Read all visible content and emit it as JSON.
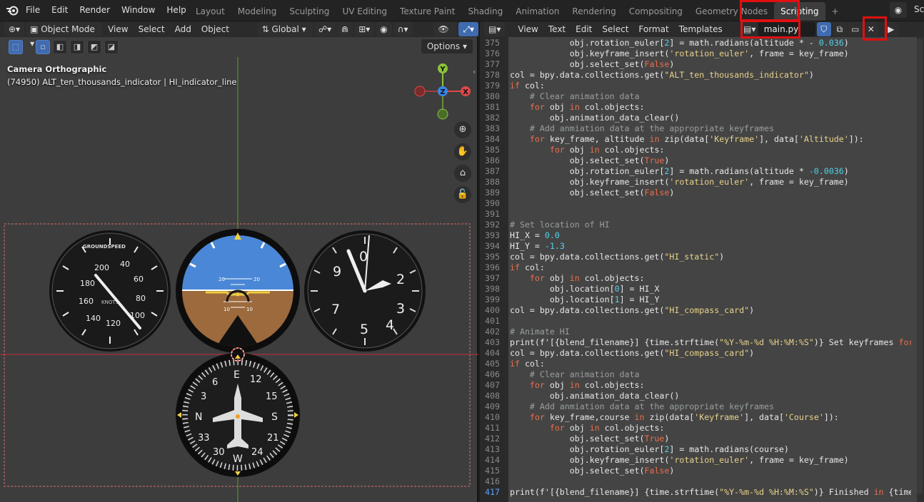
{
  "menu": {
    "items": [
      "File",
      "Edit",
      "Render",
      "Window",
      "Help"
    ]
  },
  "workspaces": [
    {
      "label": "Layout"
    },
    {
      "label": "Modeling"
    },
    {
      "label": "Sculpting"
    },
    {
      "label": "UV Editing"
    },
    {
      "label": "Texture Paint"
    },
    {
      "label": "Shading"
    },
    {
      "label": "Animation"
    },
    {
      "label": "Rendering"
    },
    {
      "label": "Compositing"
    },
    {
      "label": "Geometry Nodes"
    },
    {
      "label": "Scripting"
    }
  ],
  "active_workspace": "Scripting",
  "topright_scene": "Sc",
  "viewport": {
    "mode": "Object Mode",
    "menu": [
      "View",
      "Select",
      "Add",
      "Object"
    ],
    "transform": "Global",
    "options": "Options",
    "info_line1": "Camera Orthographic",
    "info_line2": "(74950) ALT_ten_thousands_indicator | HI_indicator_line",
    "gizmo": {
      "y": "Y",
      "z": "Z",
      "x": "X"
    }
  },
  "instruments": {
    "airspeed": {
      "title": "GROUNDSPEED",
      "unit": "KNOTS",
      "labels": [
        "200",
        "40",
        "180",
        "60",
        "160",
        "80",
        "140",
        "100",
        "120"
      ]
    },
    "attitude": {
      "labels": [
        "20",
        "10",
        "10",
        "20",
        "20",
        "10",
        "10",
        "20"
      ]
    },
    "altimeter": {
      "labels": [
        "0",
        "9",
        "2",
        "3",
        "7",
        "5",
        "4"
      ]
    },
    "heading": {
      "labels": [
        "E",
        "12",
        "15",
        "S",
        "21",
        "24",
        "W",
        "30",
        "33",
        "N",
        "3",
        "6"
      ]
    }
  },
  "editor": {
    "menu": [
      "View",
      "Text",
      "Edit",
      "Select",
      "Format",
      "Templates"
    ],
    "filename": "main.py",
    "run_icon": "play-icon"
  },
  "code_lines": [
    {
      "n": "375",
      "t": "            obj.rotation_euler[2] = math.radians(altitude * - 0.036)"
    },
    {
      "n": "376",
      "t": "            obj.keyframe_insert('rotation_euler', frame = key_frame)"
    },
    {
      "n": "377",
      "t": "            obj.select_set(False)"
    },
    {
      "n": "378",
      "t": "col = bpy.data.collections.get(\"ALT_ten_thousands_indicator\")"
    },
    {
      "n": "379",
      "t": "if col:"
    },
    {
      "n": "380",
      "t": "    # Clear animation data"
    },
    {
      "n": "381",
      "t": "    for obj in col.objects:"
    },
    {
      "n": "382",
      "t": "        obj.animation_data_clear()"
    },
    {
      "n": "383",
      "t": "    # Add anmiation data at the appropriate keyframes"
    },
    {
      "n": "384",
      "t": "    for key_frame, altitude in zip(data['Keyframe'], data['Altitude']):"
    },
    {
      "n": "385",
      "t": "        for obj in col.objects:"
    },
    {
      "n": "386",
      "t": "            obj.select_set(True)"
    },
    {
      "n": "387",
      "t": "            obj.rotation_euler[2] = math.radians(altitude * -0.0036)"
    },
    {
      "n": "388",
      "t": "            obj.keyframe_insert('rotation_euler', frame = key_frame)"
    },
    {
      "n": "389",
      "t": "            obj.select_set(False)"
    },
    {
      "n": "390",
      "t": ""
    },
    {
      "n": "391",
      "t": ""
    },
    {
      "n": "392",
      "t": "# Set location of HI"
    },
    {
      "n": "393",
      "t": "HI_X = 0.0"
    },
    {
      "n": "394",
      "t": "HI_Y = -1.3"
    },
    {
      "n": "395",
      "t": "col = bpy.data.collections.get(\"HI_static\")"
    },
    {
      "n": "396",
      "t": "if col:"
    },
    {
      "n": "397",
      "t": "    for obj in col.objects:"
    },
    {
      "n": "398",
      "t": "        obj.location[0] = HI_X"
    },
    {
      "n": "399",
      "t": "        obj.location[1] = HI_Y"
    },
    {
      "n": "400",
      "t": "col = bpy.data.collections.get(\"HI_compass_card\")"
    },
    {
      "n": "401",
      "t": ""
    },
    {
      "n": "402",
      "t": "# Animate HI"
    },
    {
      "n": "403",
      "t": "print(f'[{blend_filename}] {time.strftime(\"%Y-%m-%d %H:%M:%S\")} Set keyframes for"
    },
    {
      "n": "404",
      "t": "col = bpy.data.collections.get(\"HI_compass_card\")"
    },
    {
      "n": "405",
      "t": "if col:"
    },
    {
      "n": "406",
      "t": "    # Clear animation data"
    },
    {
      "n": "407",
      "t": "    for obj in col.objects:"
    },
    {
      "n": "408",
      "t": "        obj.animation_data_clear()"
    },
    {
      "n": "409",
      "t": "    # Add anmiation data at the appropriate keyframes"
    },
    {
      "n": "410",
      "t": "    for key_frame,course in zip(data['Keyframe'], data['Course']):"
    },
    {
      "n": "411",
      "t": "        for obj in col.objects:"
    },
    {
      "n": "412",
      "t": "            obj.select_set(True)"
    },
    {
      "n": "413",
      "t": "            obj.rotation_euler[2] = math.radians(course)"
    },
    {
      "n": "414",
      "t": "            obj.keyframe_insert('rotation_euler', frame = key_frame)"
    },
    {
      "n": "415",
      "t": "            obj.select_set(False)"
    },
    {
      "n": "416",
      "t": ""
    },
    {
      "n": "417",
      "t": "print(f'[{blend_filename}] {time.strftime(\"%Y-%m-%d %H:%M:%S\")} Finished in {time"
    }
  ],
  "current_line": "417",
  "colors": {
    "keyword": "#eb6e4b",
    "string": "#e8d28a",
    "number": "#4fd2e8",
    "comment": "#98a09a",
    "highlight": "#e01010",
    "accent": "#3f6bb0"
  }
}
